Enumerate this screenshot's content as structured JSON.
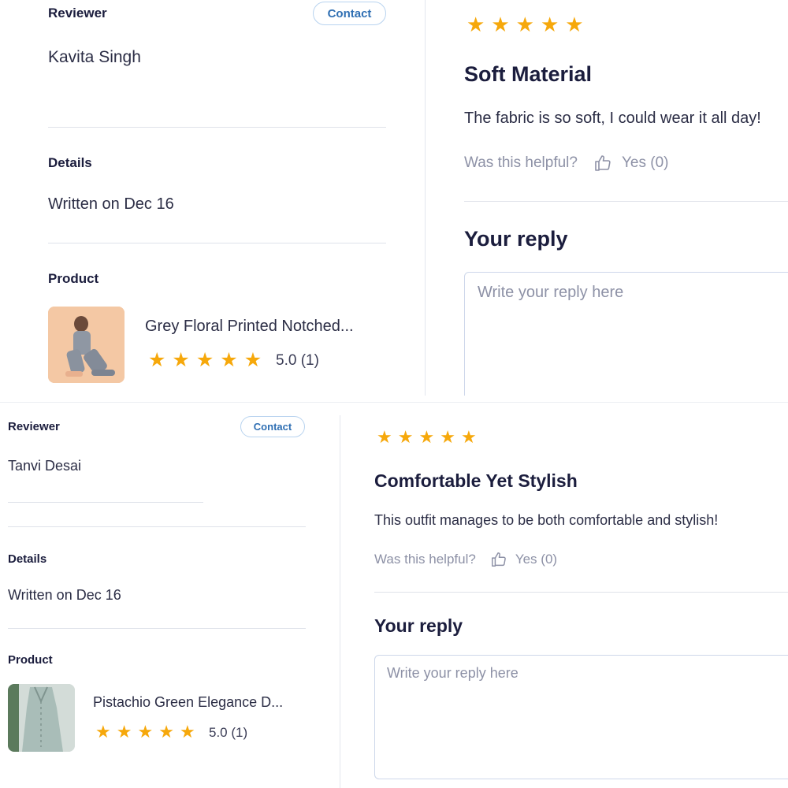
{
  "colors": {
    "star": "#f6a80b",
    "contact_border": "#b8d3ef",
    "contact_text": "#2f6fb3",
    "muted": "#8d91a6"
  },
  "reviews": [
    {
      "reviewer_label": "Reviewer",
      "contact_label": "Contact",
      "reviewer_name": "Kavita Singh",
      "details_label": "Details",
      "written_on": "Written on Dec 16",
      "product_label": "Product",
      "product_name": "Grey Floral Printed Notched...",
      "product_rating_text": "5.0 (1)",
      "product_rating": 5,
      "review_rating": 5,
      "review_title": "Soft Material",
      "review_body": "The fabric is so soft, I could wear it all day!",
      "helpful_label": "Was this helpful?",
      "helpful_yes": "Yes (0)",
      "reply_heading": "Your reply",
      "reply_placeholder": "Write your reply here"
    },
    {
      "reviewer_label": "Reviewer",
      "contact_label": "Contact",
      "reviewer_name": "Tanvi Desai",
      "details_label": "Details",
      "written_on": "Written on Dec 16",
      "product_label": "Product",
      "product_name": "Pistachio Green Elegance D...",
      "product_rating_text": "5.0 (1)",
      "product_rating": 5,
      "review_rating": 5,
      "review_title": "Comfortable Yet Stylish",
      "review_body": "This outfit manages to be both comfortable and stylish!",
      "helpful_label": "Was this helpful?",
      "helpful_yes": "Yes (0)",
      "reply_heading": "Your reply",
      "reply_placeholder": "Write your reply here"
    }
  ]
}
